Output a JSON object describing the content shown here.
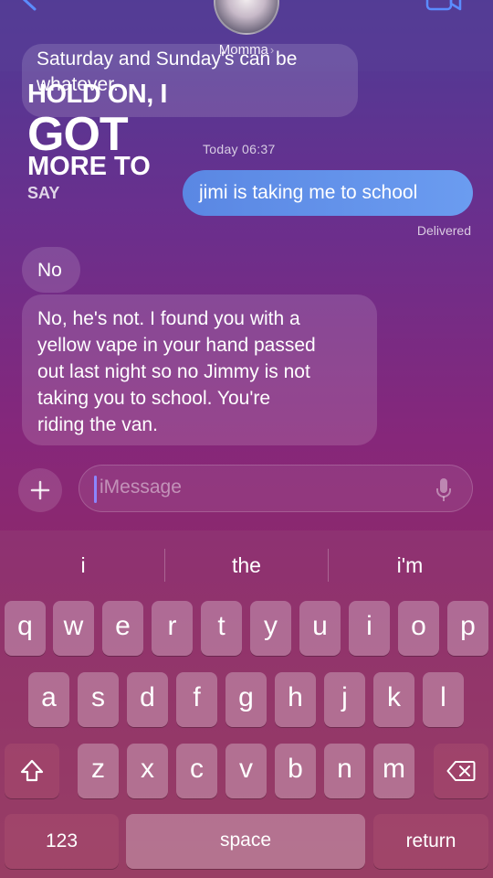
{
  "header": {
    "contact_name": "Momma",
    "chevron": "›",
    "icons": [
      "back-chevron-icon",
      "video-camera-icon"
    ]
  },
  "conversation": {
    "previous_message_lines": [
      "Saturday and Sunday's can be",
      "whatever."
    ],
    "sticker": {
      "line1": "HOLD ON, I",
      "line2": "GOT",
      "line3": "MORE TO",
      "line4": "SAY"
    },
    "timestamp": "Today 06:37",
    "outgoing_message": "jimi is taking me to school",
    "delivery_status": "Delivered",
    "incoming_short": "No",
    "incoming_long_lines": [
      "No, he's not. I found you with a",
      "yellow vape in your hand passed",
      "out last night so no Jimmy is not",
      "taking you to school. You're",
      "riding the van."
    ]
  },
  "composer": {
    "placeholder": "iMessage",
    "icons": [
      "plus-icon",
      "microphone-icon"
    ]
  },
  "keyboard": {
    "predictions": [
      "i",
      "the",
      "i'm"
    ],
    "row1": [
      "q",
      "w",
      "e",
      "r",
      "t",
      "y",
      "u",
      "i",
      "o",
      "p"
    ],
    "row2": [
      "a",
      "s",
      "d",
      "f",
      "g",
      "h",
      "j",
      "k",
      "l"
    ],
    "row3": [
      "z",
      "x",
      "c",
      "v",
      "b",
      "n",
      "m"
    ],
    "numbers_label": "123",
    "space_label": "space",
    "return_label": "return",
    "icons": [
      "shift-icon",
      "delete-icon"
    ]
  }
}
